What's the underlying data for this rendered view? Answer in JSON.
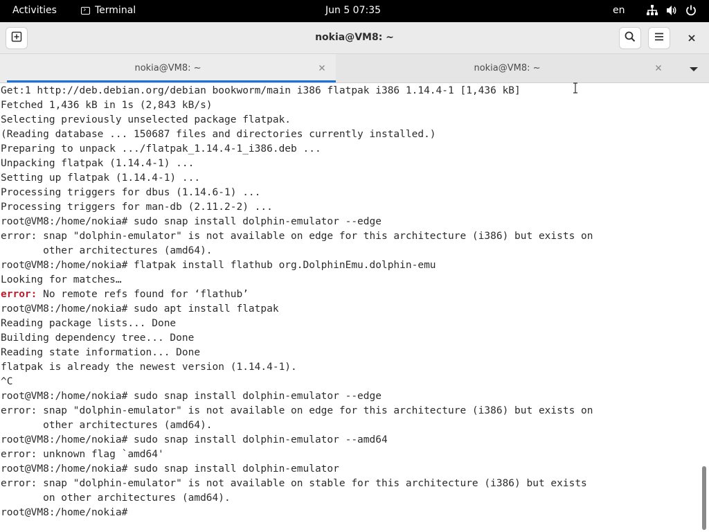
{
  "topbar": {
    "activities": "Activities",
    "app_name": "Terminal",
    "clock": "Jun 5  07:35",
    "language": "en",
    "icons": [
      "network-icon",
      "volume-icon",
      "power-icon"
    ]
  },
  "window": {
    "title": "nokia@VM8: ~",
    "new_tab_icon": "new-tab-icon",
    "search_icon": "search-icon",
    "menu_icon": "hamburger-menu-icon",
    "close_icon": "close-icon",
    "accent_color": "#1c71d8"
  },
  "tabs": [
    {
      "label": "nokia@VM8: ~",
      "active": true
    },
    {
      "label": "nokia@VM8: ~",
      "active": false
    }
  ],
  "terminal": {
    "lines": [
      "Get:1 http://deb.debian.org/debian bookworm/main i386 flatpak i386 1.14.4-1 [1,436 kB]",
      "Fetched 1,436 kB in 1s (2,843 kB/s)",
      "Selecting previously unselected package flatpak.",
      "(Reading database ... 150687 files and directories currently installed.)",
      "Preparing to unpack .../flatpak_1.14.4-1_i386.deb ...",
      "Unpacking flatpak (1.14.4-1) ...",
      "Setting up flatpak (1.14.4-1) ...",
      "Processing triggers for dbus (1.14.6-1) ...",
      "Processing triggers for man-db (2.11.2-2) ...",
      "root@VM8:/home/nokia# sudo snap install dolphin-emulator --edge",
      "error: snap \"dolphin-emulator\" is not available on edge for this architecture (i386) but exists on",
      "       other architectures (amd64).",
      "root@VM8:/home/nokia# flatpak install flathub org.DolphinEmu.dolphin-emu",
      "Looking for matches…",
      {
        "err": "error:",
        "rest": " No remote refs found for ‘flathub’"
      },
      "root@VM8:/home/nokia# sudo apt install flatpak",
      "Reading package lists... Done",
      "Building dependency tree... Done",
      "Reading state information... Done",
      "flatpak is already the newest version (1.14.4-1).",
      "^C",
      "root@VM8:/home/nokia# sudo snap install dolphin-emulator --edge",
      "error: snap \"dolphin-emulator\" is not available on edge for this architecture (i386) but exists on",
      "       other architectures (amd64).",
      "root@VM8:/home/nokia# sudo snap install dolphin-emulator --amd64",
      "error: unknown flag `amd64'",
      "root@VM8:/home/nokia# sudo snap install dolphin-emulator",
      "error: snap \"dolphin-emulator\" is not available on stable for this architecture (i386) but exists",
      "       on other architectures (amd64).",
      "root@VM8:/home/nokia# "
    ],
    "error_color": "#c01c28"
  }
}
